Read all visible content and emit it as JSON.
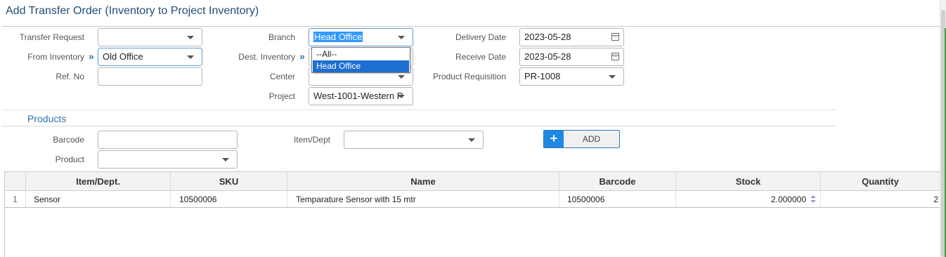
{
  "page": {
    "title": "Add Transfer Order (Inventory to Project Inventory)"
  },
  "form": {
    "transfer_request": {
      "label": "Transfer Request",
      "value": ""
    },
    "from_inventory": {
      "label": "From Inventory",
      "value": "Old Office"
    },
    "ref_no": {
      "label": "Ref. No",
      "value": ""
    },
    "branch": {
      "label": "Branch",
      "value": "Head Office"
    },
    "dest_inventory": {
      "label": "Dest. Inventory",
      "value": ""
    },
    "center": {
      "label": "Center",
      "value": ""
    },
    "project": {
      "label": "Project",
      "value": "West-1001-Western P"
    },
    "delivery_date": {
      "label": "Delivery Date",
      "value": "2023-05-28"
    },
    "receive_date": {
      "label": "Receive Date",
      "value": "2023-05-28"
    },
    "product_requisition": {
      "label": "Product Requisition",
      "value": "PR-1008"
    }
  },
  "branch_dropdown": {
    "options": [
      "--All--",
      "Head Office"
    ],
    "selected": "Head Office"
  },
  "products": {
    "section_title": "Products",
    "barcode": {
      "label": "Barcode",
      "value": ""
    },
    "product": {
      "label": "Product",
      "value": ""
    },
    "item_dept": {
      "label": "Item/Dept",
      "value": ""
    },
    "add_label": "ADD"
  },
  "grid": {
    "columns": [
      "Item/Dept.",
      "SKU",
      "Name",
      "Barcode",
      "Stock",
      "Quantity"
    ],
    "rows": [
      {
        "index": "1",
        "item_dept": "Sensor",
        "sku": "10500006",
        "name": "Temparature Sensor with 15 mtr",
        "barcode": "10500006",
        "stock": "2.000000",
        "quantity": "2"
      }
    ]
  },
  "icons": {
    "dropdown": "chevron-down-icon",
    "calendar": "calendar-icon",
    "link": "double-chevron-right-icon",
    "add": "plus-icon",
    "spinner": "spinner-arrows-icon"
  },
  "colors": {
    "title": "#1f4e79",
    "accent": "#2e75b6",
    "add_button": "#1e88e5",
    "selection": "#1e6fd0"
  }
}
